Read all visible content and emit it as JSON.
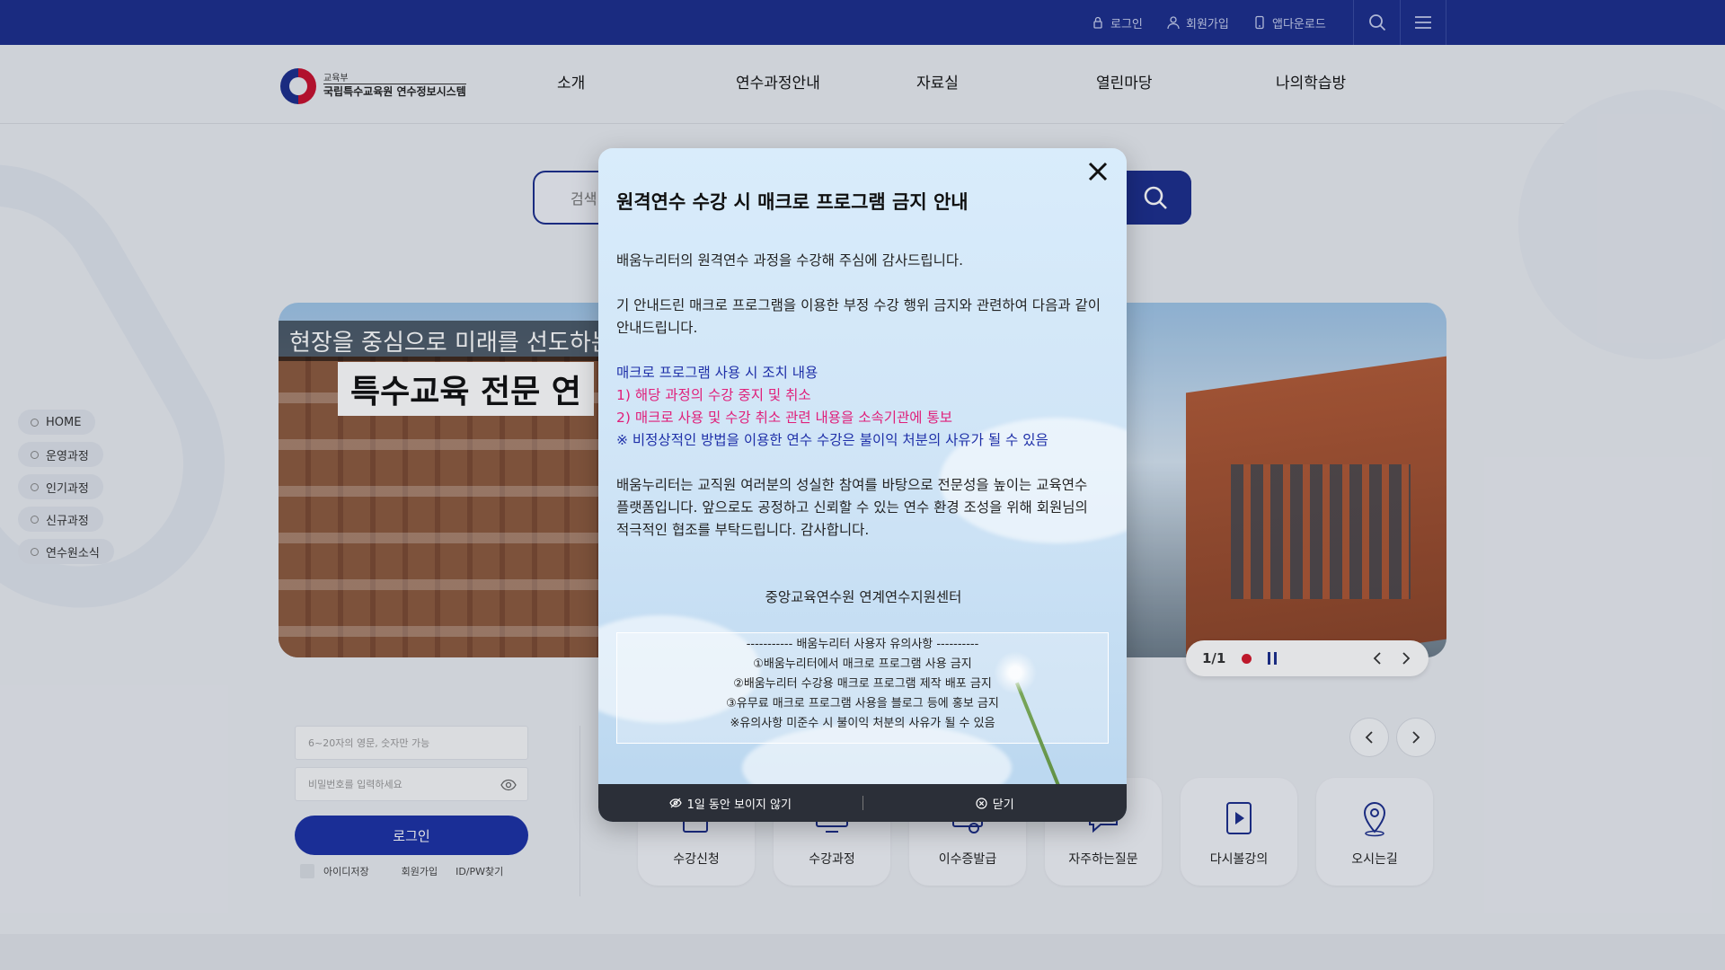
{
  "utility": {
    "login": "로그인",
    "signup": "회원가입",
    "app_download": "앱다운로드"
  },
  "header": {
    "logo_small": "교육부",
    "logo_big": "국립특수교육원 연수정보시스템",
    "nav": [
      "소개",
      "연수과정안내",
      "자료실",
      "열린마당",
      "나의학습방"
    ]
  },
  "search": {
    "placeholder": "검색"
  },
  "side_menu": [
    "HOME",
    "운영과정",
    "인기과정",
    "신규과정",
    "연수원소식"
  ],
  "banner": {
    "caption_line1": "현장을 중심으로 미래를 선도하는",
    "caption_line2": "특수교육 전문 연",
    "slide_counter": "1/1"
  },
  "login": {
    "id_placeholder": "6~20자의 영문, 숫자만 가능",
    "pw_placeholder": "비밀번호를 입력하세요",
    "login_button": "로그인",
    "save_id": "아이디저장",
    "signup": "회원가입",
    "find": "ID/PW찾기"
  },
  "quick_menu": [
    "수강신청",
    "수강과정",
    "이수증발급",
    "자주하는질문",
    "다시볼강의",
    "오시는길"
  ],
  "popup": {
    "title": "원격연수 수강 시 매크로 프로그램 금지 안내",
    "para1": "배움누리터의 원격연수 과정을 수강해 주심에 감사드립니다.",
    "para2_line1": "기 안내드린 매크로 프로그램을 이용한 부정 수강 행위 금지와 관련하여 다음과  같이",
    "para2_line2": "안내드립니다.",
    "measures_title": " 매크로 프로그램 사용 시 조치 내용",
    "measure1": " 1) 해당 과정의 수강 중지 및 취소",
    "measure2": " 2) 매크로 사용 및 수강 취소 관련 내용을 소속기관에 통보",
    "measure_note": " ※ 비정상적인 방법을 이용한 연수 수강은 불이익 처분의 사유가 될 수 있음",
    "para3_line1": "배움누리터는 교직원 여러분의 성실한 참여를 바탕으로 전문성을 높이는 교육연수",
    "para3_line2": "플랫폼입니다. 앞으로도 공정하고 신뢰할 수 있는 연수 환경 조성을 위해 회원님의",
    "para3_line3": "적극적인 협조를 부탁드립니다. 감사합니다.",
    "signature": "중앙교육연수원 연계연수지원센터",
    "rules_title": "----------- 배움누리터 사용자 유의사항 ----------",
    "rules": [
      "①배움누리터에서 매크로 프로그램 사용 금지",
      "②배움누리터 수강용 매크로 프로그램 제작 배포 금지",
      "③유무료 매크로 프로그램 사용을 블로그 등에 홍보 금지",
      "※유의사항 미준수 시 불이익 처분의 사유가 될 수 있음"
    ],
    "hide_today": "1일 동안 보이지 않기",
    "close": "닫기"
  },
  "colors": {
    "primary": "#1c2e8c",
    "pink": "#e01f7a",
    "blue_text": "#1e2fa8",
    "slide_dot": "#d7192c"
  }
}
